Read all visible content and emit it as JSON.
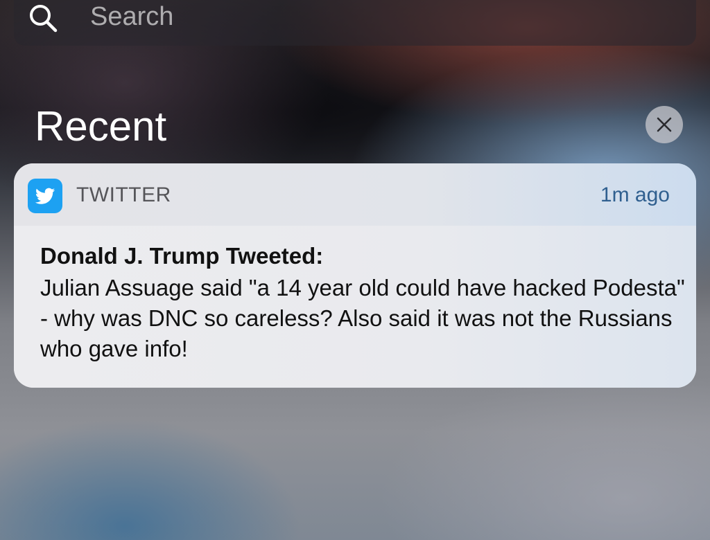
{
  "search": {
    "placeholder": "Search",
    "icon": "search-icon"
  },
  "section": {
    "title": "Recent",
    "clear_icon": "close-icon"
  },
  "notification": {
    "app_name": "TWITTER",
    "app_icon": "twitter-bird-icon",
    "timestamp": "1m ago",
    "title": "Donald J. Trump Tweeted:",
    "message": "Julian Assuage said \"a 14 year old could have hacked Podesta\" - why was DNC so careless? Also said it was not the Russians who gave info!"
  },
  "colors": {
    "twitter_blue": "#1da1f2",
    "timestamp_blue": "#2f5f8f",
    "title_white": "#ffffff"
  }
}
